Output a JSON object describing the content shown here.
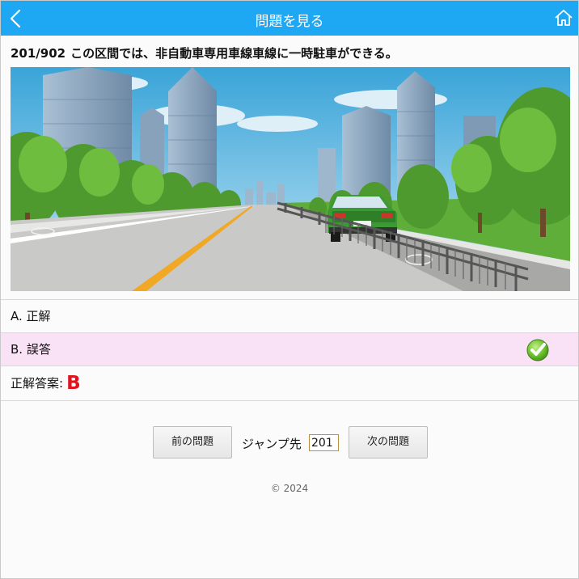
{
  "header": {
    "title": "問題を見る",
    "back_icon": "chevron-left-icon",
    "home_icon": "home-icon"
  },
  "question": {
    "number": "201/902",
    "text": "この区間では、非自動車専用車線車線に一時駐車ができる。"
  },
  "options": [
    {
      "label": "A. 正解",
      "selected": false
    },
    {
      "label": "B. 誤答",
      "selected": true
    }
  ],
  "answer": {
    "label": "正解答案:",
    "value": "B"
  },
  "nav": {
    "prev_label": "前の問題",
    "jump_label": "ジャンプ先",
    "jump_value": "201",
    "next_label": "次の問題"
  },
  "footer": {
    "copyright": "© 2024"
  },
  "colors": {
    "header": "#1ea7f2",
    "selected_option": "#f9e1f6",
    "answer": "#e0141c"
  }
}
